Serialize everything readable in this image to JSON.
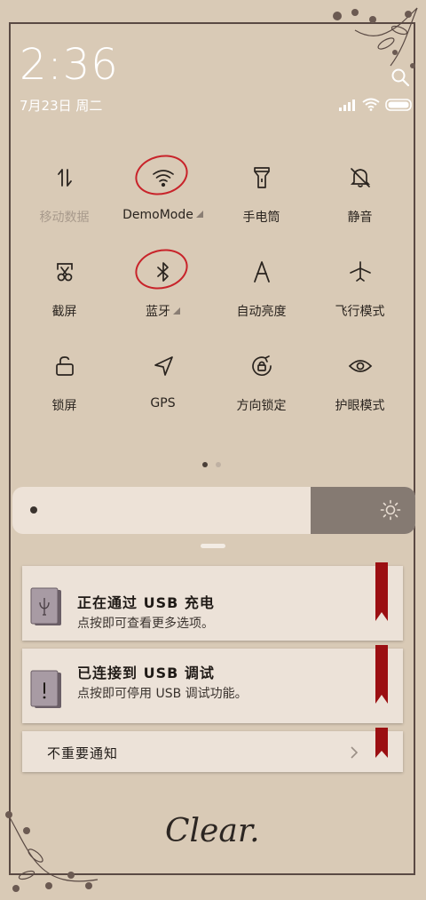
{
  "status": {
    "time": "2:36",
    "date": "7月23日 周二"
  },
  "quick_settings": [
    {
      "label": "移动数据",
      "icon": "mobile-data-icon",
      "enabled": false
    },
    {
      "label": "DemoMode",
      "icon": "wifi-icon",
      "expandable": true
    },
    {
      "label": "手电筒",
      "icon": "flashlight-icon"
    },
    {
      "label": "静音",
      "icon": "mute-icon"
    },
    {
      "label": "截屏",
      "icon": "screenshot-icon"
    },
    {
      "label": "蓝牙",
      "icon": "bluetooth-icon",
      "expandable": true
    },
    {
      "label": "自动亮度",
      "icon": "auto-brightness-icon"
    },
    {
      "label": "飞行模式",
      "icon": "airplane-icon"
    },
    {
      "label": "锁屏",
      "icon": "lock-icon"
    },
    {
      "label": "GPS",
      "icon": "gps-icon"
    },
    {
      "label": "方向锁定",
      "icon": "rotation-lock-icon"
    },
    {
      "label": "护眼模式",
      "icon": "eye-icon"
    }
  ],
  "pager": {
    "pages": 2,
    "current": 1
  },
  "brightness": {
    "level": 0.74
  },
  "notifications": [
    {
      "title": "正在通过 USB 充电",
      "subtitle": "点按即可查看更多选项。",
      "icon": "usb-charging-icon"
    },
    {
      "title": "已连接到 USB 调试",
      "subtitle": "点按即可停用 USB 调试功能。",
      "icon": "debug-warning-icon"
    }
  ],
  "minor_notifications": {
    "label": "不重要通知"
  },
  "clear_label": "Clear.",
  "colors": {
    "background": "#d9cab6",
    "ribbon": "#9b0f12",
    "circle_mark": "#c8232a",
    "card": "#ece2d8"
  }
}
